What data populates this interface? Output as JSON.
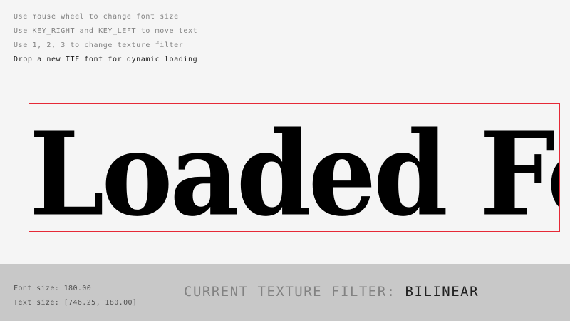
{
  "instructions": [
    "Use mouse wheel to change font size",
    "Use KEY_RIGHT and KEY_LEFT to move text",
    "Use 1, 2, 3 to change texture filter",
    "Drop a new TTF font for dynamic loading"
  ],
  "display_text": "Loaded Font",
  "stats": {
    "font_size": "Font size: 180.00",
    "text_size": "Text size: [746.25, 180.00]"
  },
  "filter": {
    "label": "CURRENT TEXTURE FILTER: ",
    "value": "BILINEAR"
  },
  "colors": {
    "background": "#f5f5f5",
    "bounding_box": "#e62937",
    "bottom_bar": "#c8c8c8"
  }
}
